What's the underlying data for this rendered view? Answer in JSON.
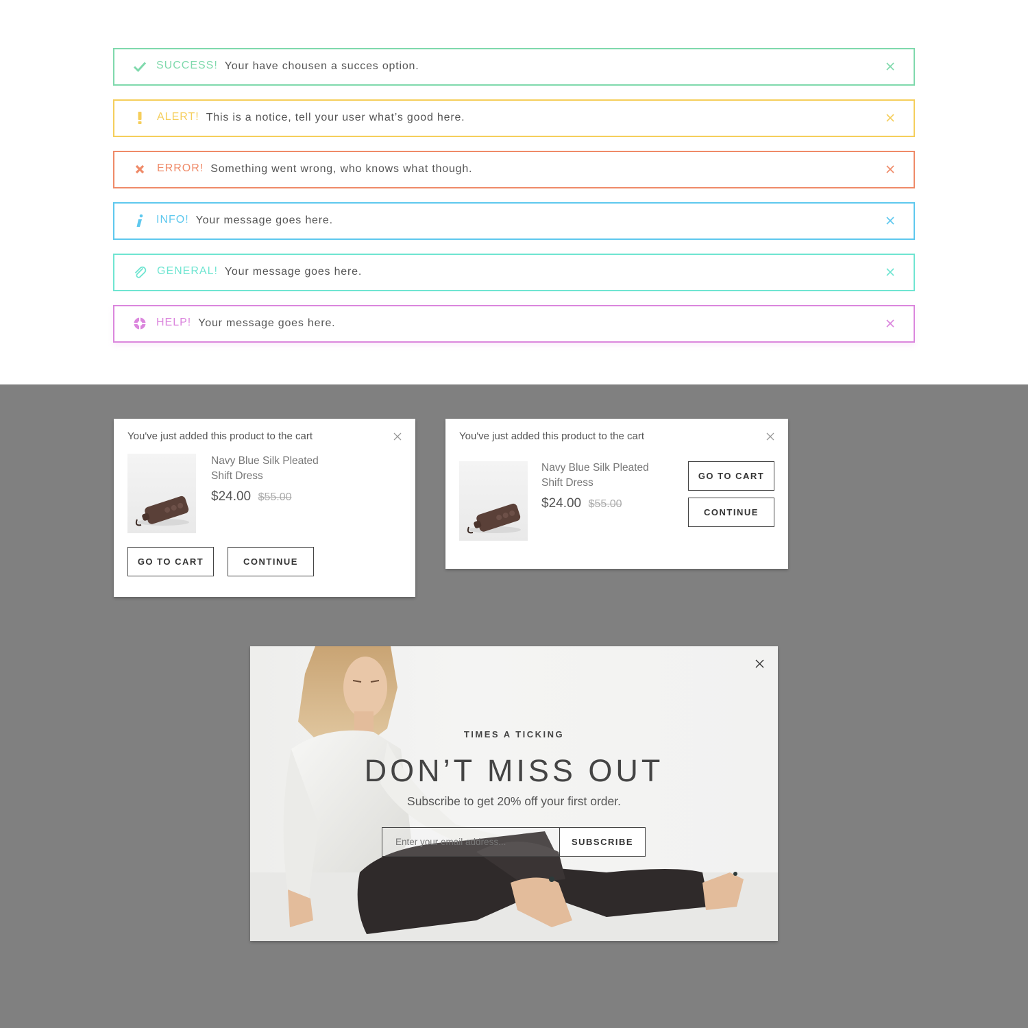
{
  "alerts": [
    {
      "label": "SUCCESS!",
      "message": "Your have chousen a succes option.",
      "color": "#7fd9ac",
      "icon": "check-icon"
    },
    {
      "label": "ALERT!",
      "message": "This is a notice, tell your user what’s good here.",
      "color": "#f5ce5b",
      "icon": "exclamation-icon"
    },
    {
      "label": "ERROR!",
      "message": "Something went wrong, who knows what though.",
      "color": "#ef8a68",
      "icon": "cross-icon"
    },
    {
      "label": "INFO!",
      "message": "Your message goes here.",
      "color": "#5ec8ee",
      "icon": "info-icon"
    },
    {
      "label": "GENERAL!",
      "message": "Your message goes here.",
      "color": "#6fe5d1",
      "icon": "paperclip-icon"
    },
    {
      "label": "HELP!",
      "message": "Your message goes here.",
      "color": "#db86dd",
      "icon": "lifebuoy-icon"
    }
  ],
  "cart_popups": [
    {
      "title": "You've just added this product to the cart",
      "product_name": "Navy Blue Silk Pleated Shift Dress",
      "price": "$24.00",
      "old_price": "$55.00",
      "go_to_cart": "GO TO CART",
      "continue": "CONTINUE"
    },
    {
      "title": "You've just added this product to the cart",
      "product_name": "Navy Blue Silk Pleated Shift Dress",
      "price": "$24.00",
      "old_price": "$55.00",
      "go_to_cart": "GO TO CART",
      "continue": "CONTINUE"
    }
  ],
  "newsletter": {
    "eyebrow": "TIMES A TICKING",
    "headline": "DON’T MISS OUT",
    "subtitle": "Subscribe to get 20% off your first order.",
    "email_placeholder": "Enter your email address...",
    "subscribe_label": "SUBSCRIBE"
  },
  "colors": {
    "dark_background": "#808080",
    "button_border": "#444444",
    "text": "#555555"
  }
}
